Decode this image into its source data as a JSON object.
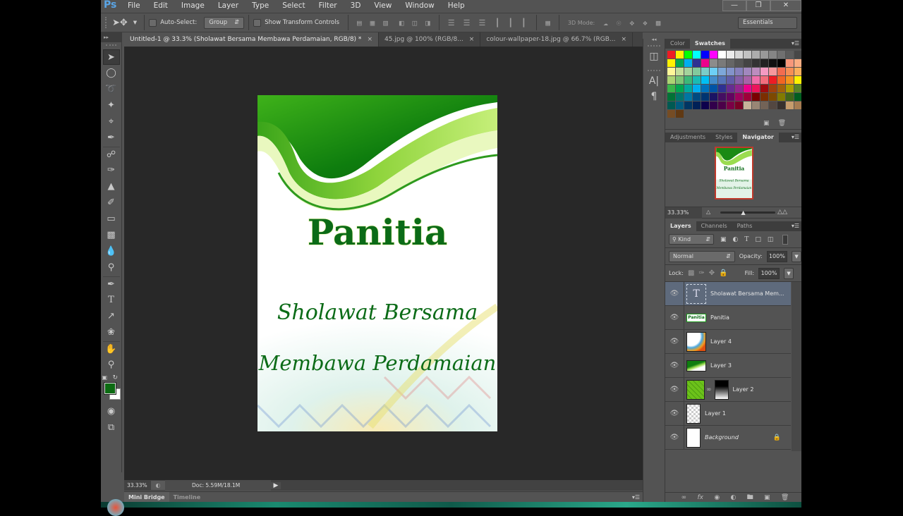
{
  "app": {
    "logo": "Ps",
    "menu": [
      "File",
      "Edit",
      "Image",
      "Layer",
      "Type",
      "Select",
      "Filter",
      "3D",
      "View",
      "Window",
      "Help"
    ],
    "window_controls": [
      "minimize",
      "restore",
      "close"
    ]
  },
  "options_bar": {
    "tool_icon": "move-tool-icon",
    "auto_select_label": "Auto-Select:",
    "auto_select_checked": false,
    "auto_select_target": "Group",
    "show_transform_label": "Show Transform Controls",
    "show_transform_checked": false,
    "align_icons": [
      "align-top",
      "align-vcenter",
      "align-bottom",
      "align-left",
      "align-hcenter",
      "align-right",
      "distribute-top",
      "distribute-vcenter",
      "distribute-bottom",
      "distribute-left",
      "distribute-hcenter",
      "distribute-right",
      "auto-align"
    ],
    "mode_3d_label": "3D Mode:",
    "mode_3d_icons": [
      "rotate-3d",
      "roll-3d",
      "drag-3d",
      "slide-3d",
      "scale-3d"
    ],
    "workspace": "Essentials"
  },
  "doc_tabs": [
    {
      "label": "Untitled-1 @ 33.3% (Sholawat Bersama Membawa Perdamaian, RGB/8) *",
      "active": true
    },
    {
      "label": "45.jpg @ 100% (RGB/8...",
      "active": false
    },
    {
      "label": "colour-wallpaper-18.jpg @ 66.7% (RGB...",
      "active": false
    }
  ],
  "tools": [
    "move",
    "marquee",
    "lasso",
    "magic-wand",
    "crop",
    "eyedropper",
    "spot-healing",
    "brush",
    "clone-stamp",
    "history-brush",
    "eraser",
    "gradient",
    "blur",
    "dodge",
    "pen",
    "type",
    "path-selection",
    "shape",
    "hand",
    "zoom"
  ],
  "colors": {
    "foreground": "#0c6b12",
    "background": "#ffffff",
    "accent_selected_layer": "#5e6a7c"
  },
  "document": {
    "title_text": "Panitia",
    "line1": "Sholawat Bersama",
    "line2": "Membawa Perdamaian",
    "text_color": "#0b6b17"
  },
  "status": {
    "zoom": "33.33%",
    "doc_info": "Doc: 5.59M/18.1M"
  },
  "bottom_tabs": [
    "Mini Bridge",
    "Timeline"
  ],
  "swatch_panel": {
    "tabs": [
      "Color",
      "Swatches"
    ],
    "active_tab": "Swatches",
    "swatches": [
      "#ee1c24",
      "#fff200",
      "#00ff00",
      "#00ffff",
      "#0000ff",
      "#ff00ff",
      "#ffffff",
      "#ebebeb",
      "#d6d6d6",
      "#c2c2c2",
      "#adadad",
      "#999999",
      "#858585",
      "#707070",
      "#5c5c5c",
      "#474747",
      "#e61e25",
      "#fff200",
      "#00a651",
      "#00aeef",
      "#2e3192",
      "#ec008c",
      "#8c8c8c",
      "#7a7a7a",
      "#666666",
      "#555555",
      "#444444",
      "#333333",
      "#222222",
      "#111111",
      "#000000",
      "#f7977a",
      "#fbad82",
      "#fdc68a",
      "#fff799",
      "#c4df9b",
      "#a3d39c",
      "#82ca9d",
      "#7accc8",
      "#6dcff6",
      "#7da7d9",
      "#8393ca",
      "#8781bd",
      "#a187be",
      "#bc8dbf",
      "#f49ac2",
      "#f6989d",
      "#f26c4f",
      "#f68e55",
      "#fbaf5c",
      "#fff568",
      "#acd373",
      "#7cc576",
      "#3bb878",
      "#1abbb4",
      "#00bff3",
      "#438ccb",
      "#5574b9",
      "#605ca8",
      "#855fa8",
      "#a763a8",
      "#f06eaa",
      "#f26d7d",
      "#ed1c24",
      "#f26522",
      "#f7941d",
      "#fff200",
      "#8dc63f",
      "#39b54a",
      "#00a651",
      "#00a99d",
      "#00aeef",
      "#0072bc",
      "#0054a6",
      "#2e3192",
      "#662d91",
      "#92278f",
      "#ec008c",
      "#ed145b",
      "#9e0b0f",
      "#a0410d",
      "#a36209",
      "#aba000",
      "#598527",
      "#197b30",
      "#007236",
      "#00746b",
      "#0076a3",
      "#004a80",
      "#003471",
      "#1b1464",
      "#440e62",
      "#630460",
      "#9e005d",
      "#9e0039",
      "#790000",
      "#7b2e00",
      "#7d4900",
      "#827b00",
      "#406618",
      "#005e20",
      "#005826",
      "#005952",
      "#005b7f",
      "#003663",
      "#002157",
      "#0d004c",
      "#32004b",
      "#4b0049",
      "#7b0046",
      "#7a0026",
      "#c7b299",
      "#998675",
      "#736357",
      "#534741",
      "#37302d",
      "#c69c6d",
      "#a67c52",
      "#8c6239",
      "#754c24",
      "#603913"
    ]
  },
  "navigator_panel": {
    "tabs": [
      "Adjustments",
      "Styles",
      "Navigator"
    ],
    "active_tab": "Navigator",
    "zoom": "33.33%",
    "zoom_slider_fraction": 0.43
  },
  "layers_panel": {
    "tabs": [
      "Layers",
      "Channels",
      "Paths"
    ],
    "active_tab": "Layers",
    "filter_kind": "Kind",
    "blend_mode": "Normal",
    "opacity_label": "Opacity:",
    "opacity": "100%",
    "lock_label": "Lock:",
    "fill_label": "Fill:",
    "fill": "100%",
    "layers": [
      {
        "name": "Sholawat Bersama Mem...",
        "type": "text",
        "visible": true,
        "selected": true
      },
      {
        "name": "Panitia",
        "type": "panitia",
        "visible": true,
        "selected": false
      },
      {
        "name": "Layer 4",
        "type": "layer4",
        "visible": true,
        "selected": false
      },
      {
        "name": "Layer 3",
        "type": "layer3",
        "visible": true,
        "selected": false
      },
      {
        "name": "Layer 2",
        "type": "masked",
        "visible": true,
        "selected": false
      },
      {
        "name": "Layer 1",
        "type": "transparent",
        "visible": true,
        "selected": false
      },
      {
        "name": "Background",
        "type": "background",
        "visible": true,
        "selected": false,
        "locked": true
      }
    ],
    "footer_icons": [
      "link-layers",
      "fx",
      "add-mask",
      "adjustment-layer",
      "new-group",
      "new-layer",
      "delete-layer"
    ]
  }
}
